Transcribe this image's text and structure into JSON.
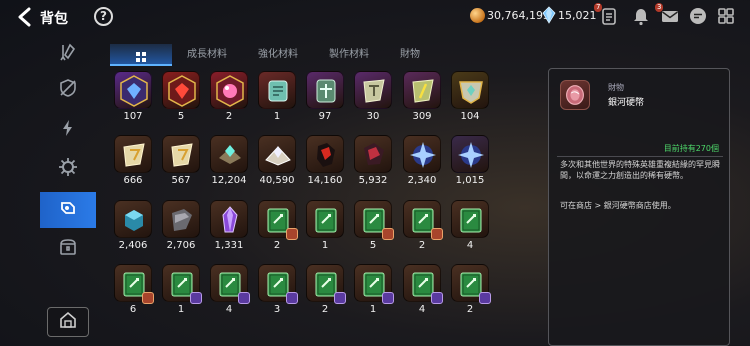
{
  "header": {
    "title": "背包",
    "gold": "30,764,195",
    "gems": "15,021",
    "notifications": {
      "alert_count": "7",
      "mail_count": "3"
    }
  },
  "icons": {
    "back": "back-arrow-icon",
    "help": "?",
    "gold": "gold-coin-icon",
    "gem": "crystal-gem-icon"
  },
  "sidebar": {
    "items": [
      "weapon-icon",
      "shield-icon",
      "lightning-icon",
      "gear-icon",
      "materials-icon",
      "chest-icon"
    ],
    "active_index": 4
  },
  "tabs": [
    {
      "label": "",
      "icon": "grid-icon",
      "active": true
    },
    {
      "label": "成長材料",
      "active": false
    },
    {
      "label": "強化材料",
      "active": false
    },
    {
      "label": "製作材料",
      "active": false
    },
    {
      "label": "財物",
      "active": false
    }
  ],
  "items": [
    [
      {
        "count": "107",
        "icon": "blue-gem-hex-icon",
        "bg": "#5a2a8a"
      },
      {
        "count": "5",
        "icon": "red-gem-hex-icon",
        "bg": "#8a1e1e"
      },
      {
        "count": "2",
        "icon": "pink-orb-hex-icon",
        "bg": "#8a1e2a"
      },
      {
        "count": "1",
        "icon": "tablet-icon",
        "bg": "#6a2a28"
      },
      {
        "count": "97",
        "icon": "cross-tablet-icon",
        "bg": "#5a2a6a"
      },
      {
        "count": "30",
        "icon": "stone-t-icon",
        "bg": "#5a2a6a"
      },
      {
        "count": "309",
        "icon": "stone-slash-icon",
        "bg": "#5a2a5a"
      },
      {
        "count": "104",
        "icon": "emblem-icon",
        "bg": "#4a3a18"
      }
    ],
    [
      {
        "count": "666",
        "icon": "gold-stone-icon",
        "bg": "#4a3022"
      },
      {
        "count": "567",
        "icon": "gold-stone-icon",
        "bg": "#4a3022"
      },
      {
        "count": "12,204",
        "icon": "cyan-crystal-icon",
        "bg": "#4a3022"
      },
      {
        "count": "40,590",
        "icon": "crystal-shard-icon",
        "bg": "#4a3022"
      },
      {
        "count": "14,160",
        "icon": "red-ore-icon",
        "bg": "#4a3022"
      },
      {
        "count": "5,932",
        "icon": "dark-ore-icon",
        "bg": "#4a3022"
      },
      {
        "count": "2,340",
        "icon": "blue-star-icon",
        "bg": "#4a3022"
      },
      {
        "count": "1,015",
        "icon": "blue-star-icon",
        "bg": "#3a2a4a"
      }
    ],
    [
      {
        "count": "2,406",
        "icon": "blue-cube-icon",
        "bg": "#4a3022"
      },
      {
        "count": "2,706",
        "icon": "scrap-icon",
        "bg": "#4a3022"
      },
      {
        "count": "1,331",
        "icon": "purple-crystal-icon",
        "bg": "#4a3022"
      },
      {
        "count": "2",
        "icon": "skill-book-icon",
        "bg": "#4a3022",
        "badge": "red"
      },
      {
        "count": "1",
        "icon": "skill-book-icon",
        "bg": "#4a3022",
        "badge": ""
      },
      {
        "count": "5",
        "icon": "skill-book-icon",
        "bg": "#4a3022",
        "badge": "red"
      },
      {
        "count": "2",
        "icon": "skill-book-icon",
        "bg": "#4a3022",
        "badge": "red"
      },
      {
        "count": "4",
        "icon": "skill-book-icon",
        "bg": "#4a3022",
        "badge": ""
      }
    ],
    [
      {
        "count": "6",
        "icon": "skill-book-icon",
        "bg": "#4a3022",
        "badge": "red"
      },
      {
        "count": "1",
        "icon": "skill-book-icon",
        "bg": "#4a3022",
        "badge": "purple"
      },
      {
        "count": "4",
        "icon": "skill-book-icon",
        "bg": "#4a3022",
        "badge": "purple"
      },
      {
        "count": "3",
        "icon": "skill-book-icon",
        "bg": "#4a3022",
        "badge": "purple"
      },
      {
        "count": "2",
        "icon": "skill-book-icon",
        "bg": "#4a3022",
        "badge": "purple"
      },
      {
        "count": "1",
        "icon": "skill-book-icon",
        "bg": "#4a3022",
        "badge": "purple"
      },
      {
        "count": "4",
        "icon": "skill-book-icon",
        "bg": "#4a3022",
        "badge": "purple"
      },
      {
        "count": "2",
        "icon": "skill-book-icon",
        "bg": "#4a3022",
        "badge": "purple"
      }
    ]
  ],
  "detail": {
    "category": "財物",
    "name": "銀河硬幣",
    "held": "目前持有270個",
    "description": "多次和其他世界的特殊英雄重複結緣的罕見瞬間，以命運之力創造出的稀有硬幣。",
    "source": "可在商店 > 銀河硬幣商店使用。"
  },
  "colors": {
    "accent_blue": "#2b7be8",
    "held_green": "#4ed86a",
    "badge_red": "#a8452c",
    "badge_purple": "#5a3aa0"
  }
}
